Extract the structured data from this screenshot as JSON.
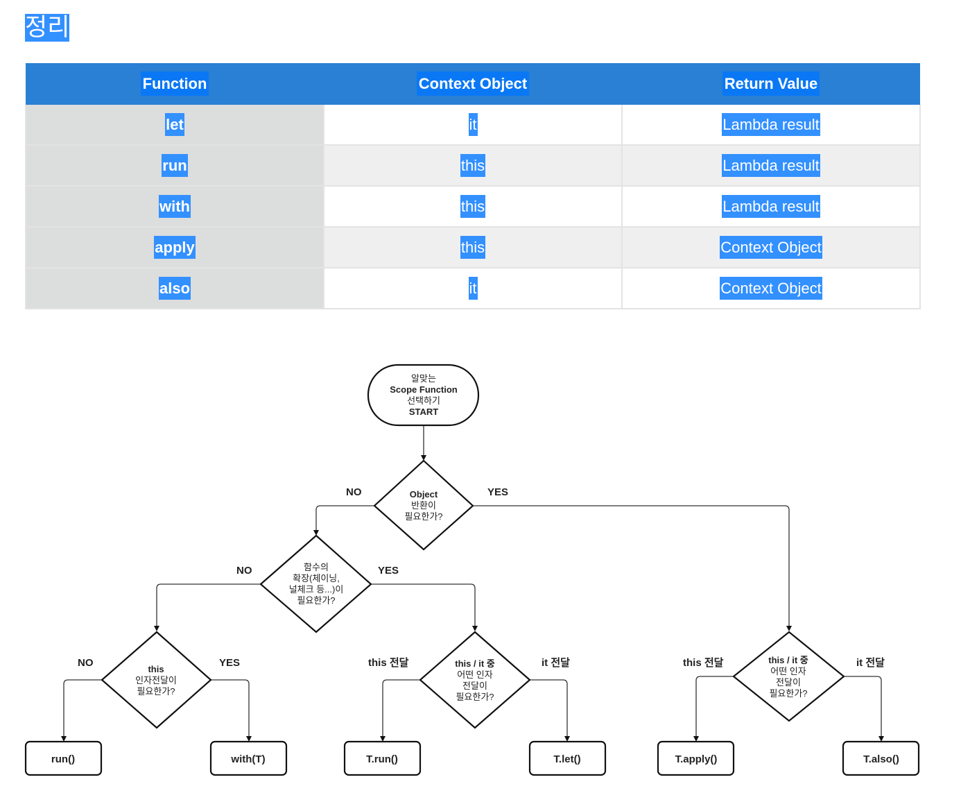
{
  "heading": "정리",
  "table": {
    "headers": [
      "Function",
      "Context Object",
      "Return Value"
    ],
    "rows": [
      {
        "function": "let",
        "context": "it",
        "return": "Lambda result"
      },
      {
        "function": "run",
        "context": "this",
        "return": "Lambda result"
      },
      {
        "function": "with",
        "context": "this",
        "return": "Lambda result"
      },
      {
        "function": "apply",
        "context": "this",
        "return": "Context Object"
      },
      {
        "function": "also",
        "context": "it",
        "return": "Context Object"
      }
    ]
  },
  "flowchart": {
    "start": {
      "lines": [
        "알맞는",
        "Scope Function",
        "선택하기",
        "START"
      ]
    },
    "decision_object_return": {
      "lines": [
        "Object",
        "반환이",
        "필요한가?"
      ],
      "no": "NO",
      "yes": "YES"
    },
    "decision_extension": {
      "lines": [
        "함수의",
        "확장(체이닝,",
        "널체크 등...)이",
        "필요한가?"
      ],
      "no": "NO",
      "yes": "YES"
    },
    "decision_this_arg": {
      "lines": [
        "this",
        "인자전달이",
        "필요한가?"
      ],
      "no": "NO",
      "yes": "YES"
    },
    "decision_this_it_mid": {
      "lines": [
        "this / it 중",
        "어떤 인자",
        "전달이",
        "필요한가?"
      ],
      "left": "this 전달",
      "right": "it 전달"
    },
    "decision_this_it_right": {
      "lines": [
        "this / it 중",
        "어떤 인자",
        "전달이",
        "필요한가?"
      ],
      "left": "this 전달",
      "right": "it 전달"
    },
    "results": {
      "run": "run()",
      "with": "with(T)",
      "t_run": "T.run()",
      "t_let": "T.let()",
      "t_apply": "T.apply()",
      "t_also": "T.also()"
    }
  }
}
